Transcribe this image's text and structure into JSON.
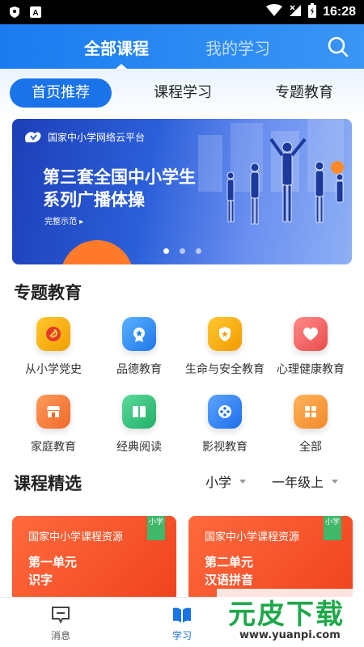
{
  "status_bar": {
    "time": "16:28"
  },
  "header": {
    "tabs": [
      {
        "label": "全部课程",
        "active": true
      },
      {
        "label": "我的学习",
        "active": false
      }
    ]
  },
  "segments": [
    "首页推荐",
    "课程学习",
    "专题教育"
  ],
  "banner": {
    "logo_text": "国家中小学网络云平台",
    "title_line1": "第三套全国中小学生",
    "title_line2": "系列广播体操",
    "subtitle": "完整示范 ▸",
    "dots": 3,
    "active_dot": 0
  },
  "topic_section": {
    "title": "专题教育",
    "items": [
      {
        "label": "从小学党史",
        "icon": "party-history-icon",
        "color": "#f2b300"
      },
      {
        "label": "品德教育",
        "icon": "medal-icon",
        "color": "#2f8cf0"
      },
      {
        "label": "生命与安全教育",
        "icon": "shield-icon",
        "color": "#f5a100"
      },
      {
        "label": "心理健康教育",
        "icon": "heart-icon",
        "color": "#f05a5a"
      },
      {
        "label": "家庭教育",
        "icon": "home-icon",
        "color": "#f07a3a"
      },
      {
        "label": "经典阅读",
        "icon": "book-icon",
        "color": "#2ebf7a"
      },
      {
        "label": "影视教育",
        "icon": "film-reel-icon",
        "color": "#2f7ff0"
      },
      {
        "label": "全部",
        "icon": "grid-icon",
        "color": "#f59a3a"
      }
    ]
  },
  "course_section": {
    "title": "课程精选",
    "filter_stage": "小学",
    "filter_grade": "一年级上"
  },
  "cards": [
    {
      "source": "国家中小学课程资源",
      "badge": "小学",
      "unit": "第一单元",
      "topic": "识字"
    },
    {
      "source": "国家中小学课程资源",
      "badge": "小学",
      "unit": "第二单元",
      "topic": "汉语拼音"
    }
  ],
  "bottom_nav": [
    {
      "label": "消息",
      "icon": "message-icon",
      "active": false
    },
    {
      "label": "学习",
      "icon": "open-book-icon",
      "active": true
    }
  ],
  "watermark": {
    "main": "元皮下载",
    "url": "www.yuanpi.com"
  }
}
